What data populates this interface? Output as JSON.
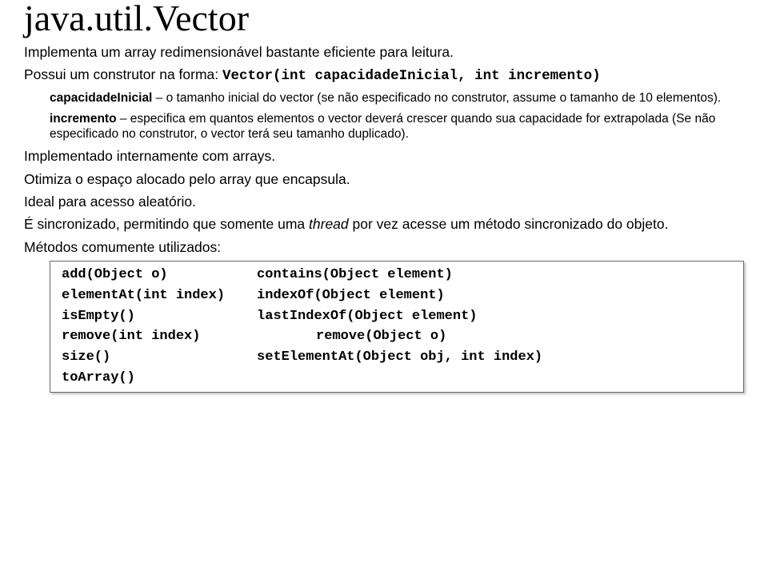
{
  "title": "java.util.Vector",
  "content": {
    "p1": "Implementa um array redimensionável bastante eficiente para leitura.",
    "p2_pre": "Possui um construtor na forma: ",
    "p2_code": "Vector(int capacidadeInicial, int incremento)",
    "sub1_bold": "capacidadeInicial",
    "sub1_rest": " – o tamanho inicial do vector (se não especificado no construtor, assume o tamanho de 10 elementos).",
    "sub2_bold": "incremento",
    "sub2_rest": " – especifica em quantos elementos o vector deverá crescer quando sua capacidade for extrapolada (Se não especificado no construtor, o vector terá seu tamanho duplicado).",
    "p3": "Implementado internamente com arrays.",
    "p4": "Otimiza o espaço alocado pelo array que encapsula.",
    "p5": "Ideal para acesso aleatório.",
    "p6_a": "É sincronizado, permitindo que somente uma ",
    "p6_i": "thread",
    "p6_b": " por vez acesse um método sincronizado do objeto.",
    "p7": "Métodos comumente utilizados:"
  },
  "methods": {
    "col1": [
      "add(Object o)",
      "elementAt(int index)",
      "isEmpty()",
      "remove(int index)",
      "size()",
      "toArray()"
    ],
    "col2": [
      "contains(Object element)",
      "indexOf(Object element)",
      "lastIndexOf(Object element)",
      "remove(Object o)",
      "setElementAt(Object obj, int index)"
    ]
  }
}
